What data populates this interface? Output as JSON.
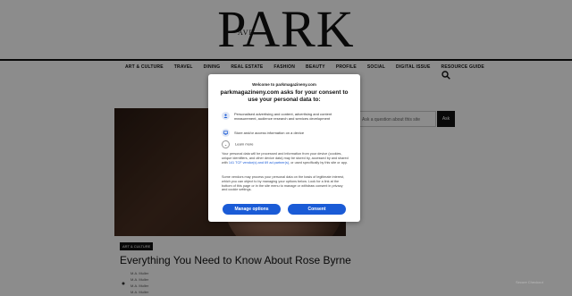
{
  "site": {
    "logo": "PARK",
    "logo_small": "AVE"
  },
  "nav": {
    "items": [
      "ART & CULTURE",
      "TRAVEL",
      "DINING",
      "REAL ESTATE",
      "FASHION",
      "BEAUTY",
      "PROFILE",
      "SOCIAL",
      "DIGITAL ISSUE",
      "RESOURCE GUIDE"
    ]
  },
  "sidebar": {
    "ask_placeholder": "Ask a question about this site",
    "ask_button": "Ask"
  },
  "article": {
    "tag": "ART & CULTURE",
    "headline": "Everything You Need to Know About Rose Byrne",
    "bylines": [
      "M.A. Muller",
      "M.A. Muller",
      "M.A. Muller",
      "M.A. Muller"
    ]
  },
  "consent": {
    "site": "Welcome to parkmagazineny.com",
    "title": "parkmagazineny.com asks for your consent to use your personal data to:",
    "purpose_1": "Personalised advertising and content, advertising and content measurement, audience research and services development",
    "purpose_2": "Store and/or access information on a device",
    "learn_more": "Learn more",
    "para_1_a": "Your personal data will be processed and information from your device (cookies, unique identifiers, and other device data) may be stored by, accessed by and shared with ",
    "para_1_link": "141 TCF vendor(s) and 69 ad partner(s)",
    "para_1_b": ", or used specifically by this site or app.",
    "para_2": "Some vendors may process your personal data on the basis of legitimate interest, which you can object to by managing your options below. Look for a link at the bottom of this page or in the site menu to manage or withdraw consent in privacy and cookie settings.",
    "manage_button": "Manage options",
    "consent_button": "Consent"
  },
  "badge": "Secure Checkout"
}
